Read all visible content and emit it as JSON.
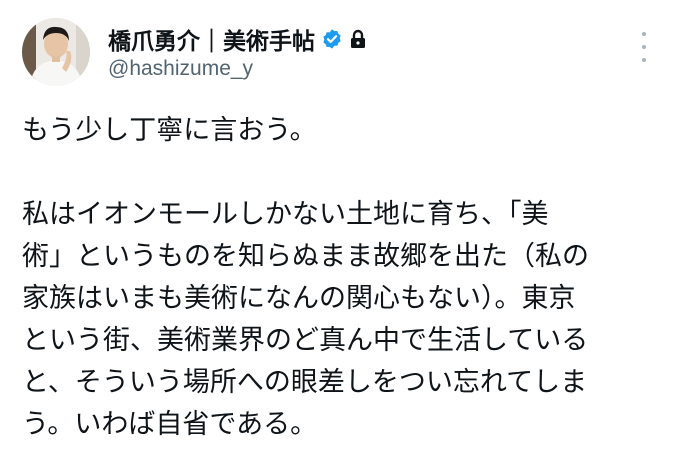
{
  "author": {
    "display_name": "橋爪勇介｜美術手帖",
    "handle": "@hashizume_y",
    "avatar_icon": "user-avatar",
    "verified_icon": "verified-badge-icon",
    "lock_icon": "lock-icon",
    "verified_color": "#1d9bf0"
  },
  "more_icon": "more-vertical-icon",
  "tweet": {
    "paragraph_1": "もう少し丁寧に言おう。",
    "paragraph_2_lines": [
      "私はイオンモールしかない土地に育ち、「美",
      "術」というものを知らぬまま故郷を出た（私の",
      "家族はいまも美術になんの関心もない）。東京",
      "という街、美術業界のど真ん中で生活している",
      "と、そういう場所への眼差しをつい忘れてしま",
      "う。いわば自省である。"
    ]
  }
}
